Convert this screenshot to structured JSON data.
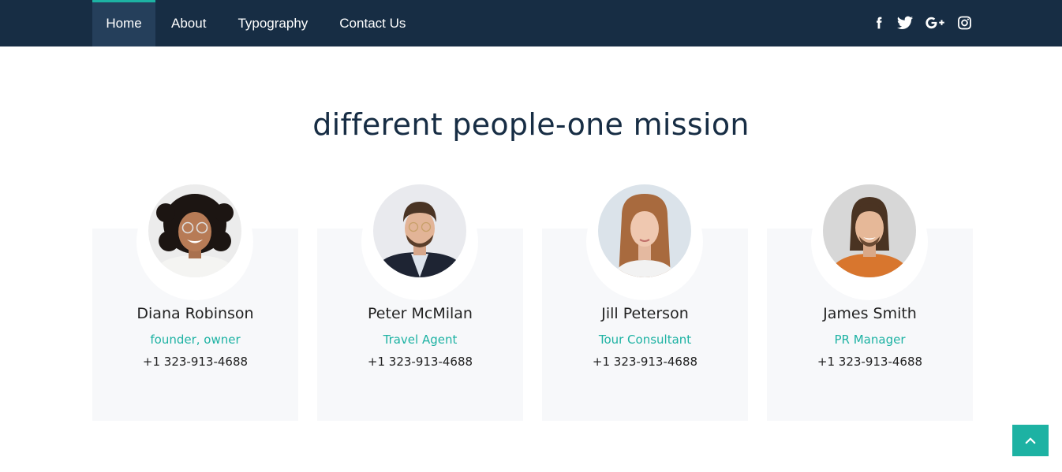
{
  "nav": {
    "items": [
      {
        "label": "Home",
        "active": true
      },
      {
        "label": "About"
      },
      {
        "label": "Typography"
      },
      {
        "label": "Contact Us"
      }
    ],
    "social": [
      "facebook-icon",
      "twitter-icon",
      "google-plus-icon",
      "instagram-icon"
    ]
  },
  "team": {
    "title": "different people-one mission",
    "members": [
      {
        "name": "Diana Robinson",
        "role": "founder, owner",
        "phone": "+1 323-913-4688"
      },
      {
        "name": "Peter McMilan",
        "role": "Travel Agent",
        "phone": "+1 323-913-4688"
      },
      {
        "name": "Jill Peterson",
        "role": "Tour Consultant",
        "phone": "+1 323-913-4688"
      },
      {
        "name": "James Smith",
        "role": "PR Manager",
        "phone": "+1 323-913-4688"
      }
    ]
  },
  "colors": {
    "navbar": "#172d44",
    "accent": "#1db2a3",
    "card_bg": "#f7f8fa"
  },
  "back_to_top": {
    "icon": "chevron-up-icon"
  }
}
